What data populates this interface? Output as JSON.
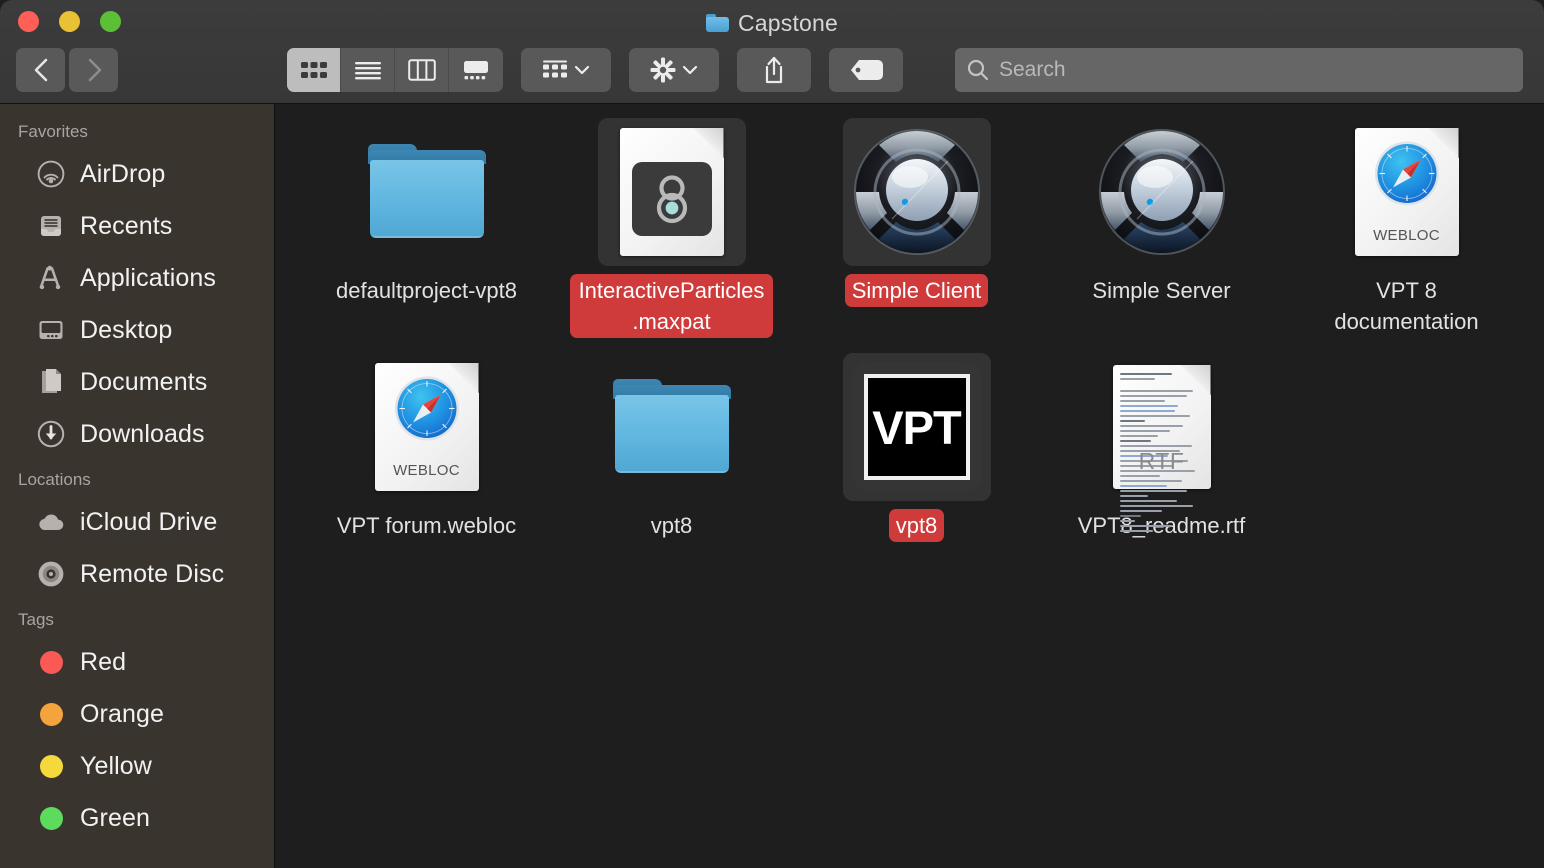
{
  "window": {
    "title": "Capstone",
    "title_icon": "folder-icon",
    "traffic_lights": [
      {
        "name": "close-button",
        "color": "#ff5f57"
      },
      {
        "name": "minimize-button",
        "color": "#e8c234"
      },
      {
        "name": "maximize-button",
        "color": "#5cc036"
      }
    ]
  },
  "toolbar": {
    "back_label": "Back",
    "forward_label": "Forward",
    "view_modes": [
      {
        "name": "icon-view",
        "label": "Icon View",
        "active": true
      },
      {
        "name": "list-view",
        "label": "List View",
        "active": false
      },
      {
        "name": "column-view",
        "label": "Column View",
        "active": false
      },
      {
        "name": "gallery-view",
        "label": "Gallery View",
        "active": false
      }
    ],
    "group_label": "Group",
    "action_label": "Action",
    "share_label": "Share",
    "tag_label": "Tags"
  },
  "search": {
    "placeholder": "Search",
    "value": ""
  },
  "sidebar": {
    "sections": [
      {
        "header": "Favorites",
        "items": [
          {
            "label": "AirDrop",
            "icon": "airdrop-icon"
          },
          {
            "label": "Recents",
            "icon": "recents-icon"
          },
          {
            "label": "Applications",
            "icon": "applications-icon"
          },
          {
            "label": "Desktop",
            "icon": "desktop-icon"
          },
          {
            "label": "Documents",
            "icon": "documents-icon"
          },
          {
            "label": "Downloads",
            "icon": "downloads-icon"
          }
        ]
      },
      {
        "header": "Locations",
        "items": [
          {
            "label": "iCloud Drive",
            "icon": "icloud-icon"
          },
          {
            "label": "Remote Disc",
            "icon": "disc-icon"
          }
        ]
      },
      {
        "header": "Tags",
        "items": [
          {
            "label": "Red",
            "icon": "tag-dot-icon",
            "color": "#fa5a55"
          },
          {
            "label": "Orange",
            "icon": "tag-dot-icon",
            "color": "#f5a33c"
          },
          {
            "label": "Yellow",
            "icon": "tag-dot-icon",
            "color": "#f5d93c"
          },
          {
            "label": "Green",
            "icon": "tag-dot-icon",
            "color": "#5cdb5c"
          }
        ]
      }
    ]
  },
  "files": [
    {
      "name": "defaultproject-vpt8",
      "kind": "folder",
      "selected": false,
      "highlighted": false
    },
    {
      "name": "InteractiveParticles.maxpat",
      "kind": "maxpat",
      "selected": true,
      "highlighted": true
    },
    {
      "name": "Simple Client",
      "kind": "max-app",
      "selected": true,
      "highlighted": true
    },
    {
      "name": "Simple Server",
      "kind": "max-app",
      "selected": false,
      "highlighted": false
    },
    {
      "name": "VPT 8 documentation",
      "kind": "webloc",
      "selected": false,
      "highlighted": false
    },
    {
      "name": "VPT forum.webloc",
      "kind": "webloc",
      "selected": false,
      "highlighted": false
    },
    {
      "name": "vpt8",
      "kind": "folder",
      "selected": false,
      "highlighted": false
    },
    {
      "name": "vpt8",
      "kind": "vpt-app",
      "selected": true,
      "highlighted": true
    },
    {
      "name": "VPT8_readme.rtf",
      "kind": "rtf",
      "selected": false,
      "highlighted": false
    }
  ],
  "colors": {
    "selection_red": "#cf3b3b",
    "content_bg": "#1e1e1e",
    "sidebar_bg": "#3a342f",
    "toolbar_bg": "#3a3a3a",
    "folder_blue": "#5fb6df"
  },
  "labels": {
    "webloc_badge": "WEBLOC",
    "rtf_badge": "RTF",
    "vpt_badge": "VPT"
  }
}
